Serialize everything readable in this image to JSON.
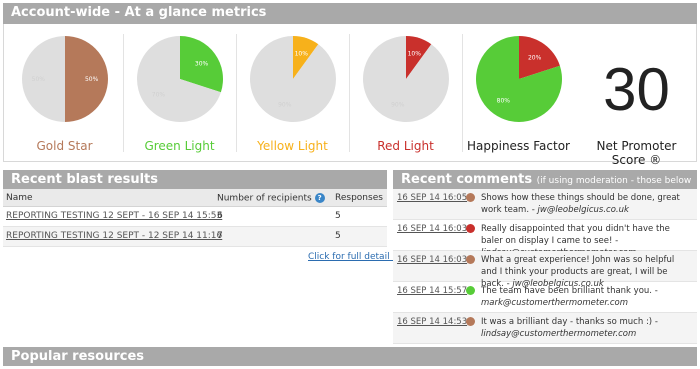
{
  "metrics": {
    "title": "Account-wide - At a glance metrics",
    "items": [
      {
        "label": "Gold Star",
        "color": "#b5795a",
        "percent": 50,
        "rest_percent": 50,
        "percent_text": "50%",
        "rest_text": "50%"
      },
      {
        "label": "Green Light",
        "color": "#57cc38",
        "percent": 30,
        "rest_percent": 70,
        "percent_text": "30%",
        "rest_text": "70%"
      },
      {
        "label": "Yellow Light",
        "color": "#f7b11b",
        "percent": 10,
        "rest_percent": 90,
        "percent_text": "10%",
        "rest_text": "90%"
      },
      {
        "label": "Red Light",
        "color": "#c9302c",
        "percent": 10,
        "rest_percent": 90,
        "percent_text": "10%",
        "rest_text": "90%"
      },
      {
        "label": "Happiness Factor",
        "color": "#57cc38",
        "second_color": "#c9302c",
        "percent": 80,
        "rest_percent": 20,
        "percent_text": "80%",
        "rest_text": "20%"
      }
    ],
    "nps": {
      "label": "Net Promoter Score ®",
      "value": "30"
    }
  },
  "blast": {
    "title": "Recent blast results",
    "columns": [
      "Name",
      "Number of recipients",
      "Responses"
    ],
    "help_icon": "?",
    "rows": [
      {
        "name": "REPORTING TESTING 12 SEPT - 16 SEP 14 15:53",
        "recipients": "6",
        "responses": "5"
      },
      {
        "name": "REPORTING TESTING 12 SEPT - 12 SEP 14 11:16",
        "recipients": "7",
        "responses": "5"
      }
    ],
    "full_detail": "Click for full detail »"
  },
  "comments": {
    "title": "Recent comments",
    "note": "(if using moderation - those below are visible to public)",
    "items": [
      {
        "date": "16 SEP 14 16:05",
        "color": "#b5795a",
        "text": "Shows how these things should be done, great work team. -",
        "email": "jw@leobelgicus.co.uk"
      },
      {
        "date": "16 SEP 14 16:03",
        "color": "#c9302c",
        "text": "Really disappointed that you didn't have the baler on display I came to see! -",
        "email": "lindsay@customerthermometer.com"
      },
      {
        "date": "16 SEP 14 16:03",
        "color": "#b5795a",
        "text": "What a great experience! John was so helpful and I think your products are great, I will be back. -",
        "email": "jw@leobelgicus.co.uk"
      },
      {
        "date": "16 SEP 14 15:57",
        "color": "#57cc38",
        "text": "The team have been brilliant thank you. -",
        "email": "mark@customerthermometer.com"
      },
      {
        "date": "16 SEP 14 14:53",
        "color": "#b5795a",
        "text": "It was a brilliant day - thanks so much :) -",
        "email": "lindsay@customerthermometer.com"
      }
    ]
  },
  "popular": {
    "title": "Popular resources"
  }
}
